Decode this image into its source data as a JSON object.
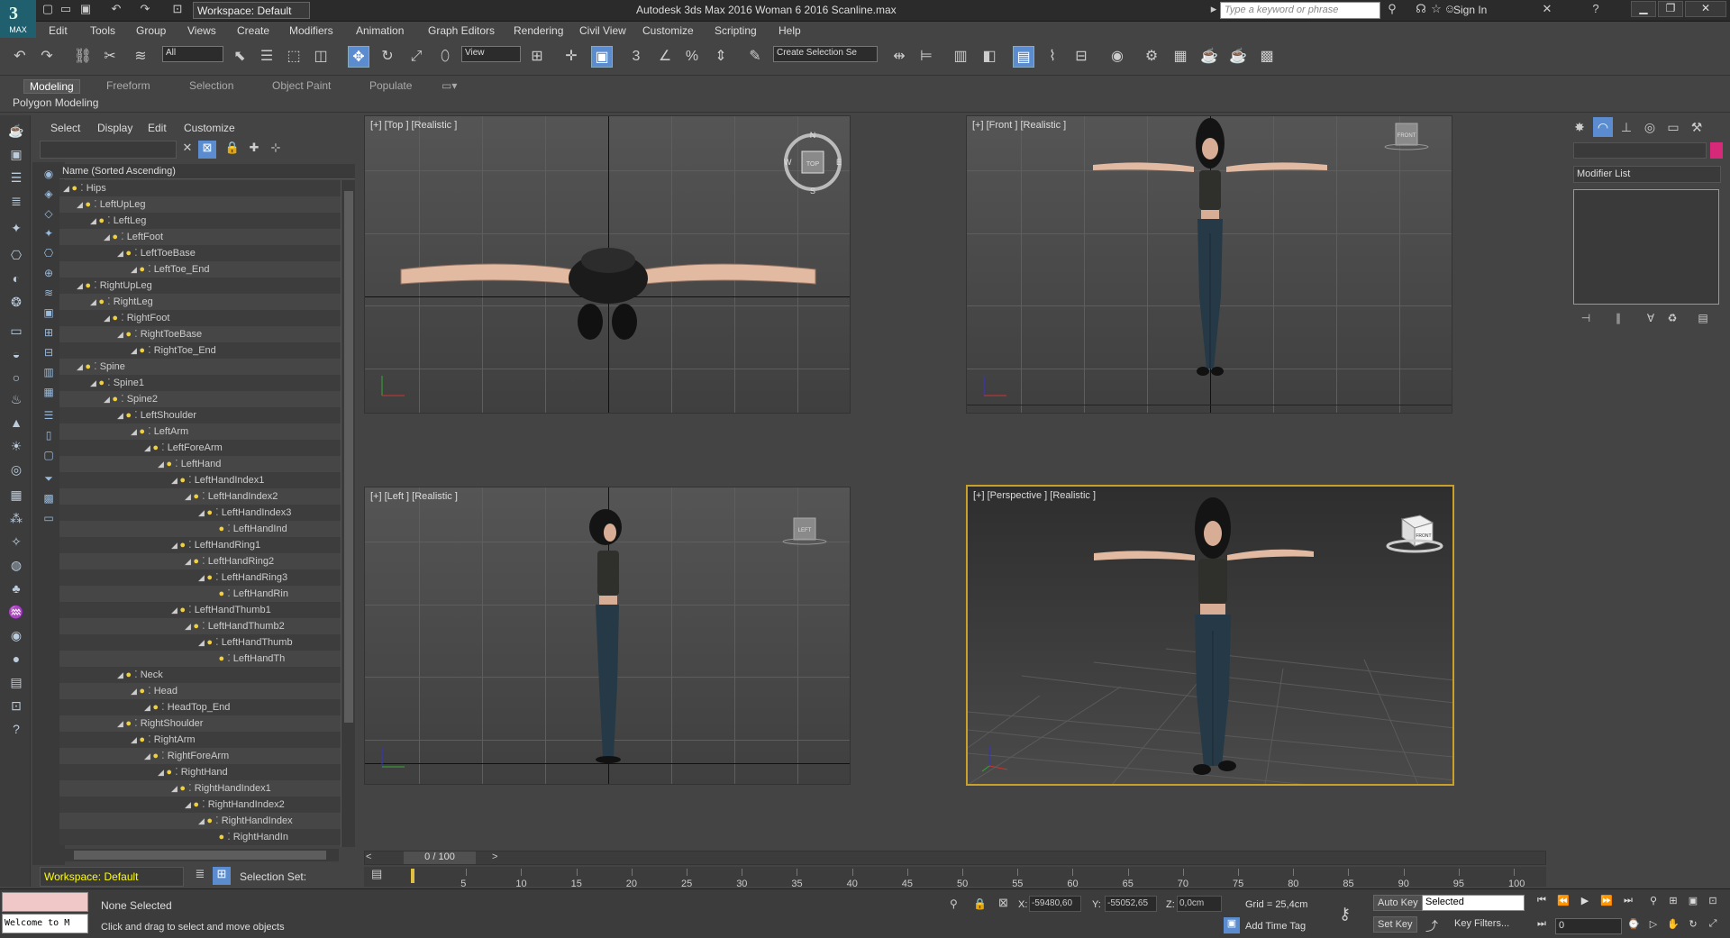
{
  "app": {
    "title": "Autodesk 3ds Max 2016    Woman 6 2016 Scanline.max",
    "logo_text": "MAX",
    "workspace_top": "Workspace: Default",
    "search_placeholder": "Type a keyword or phrase",
    "sign_in": "Sign In"
  },
  "menu": [
    "Edit",
    "Tools",
    "Group",
    "Views",
    "Create",
    "Modifiers",
    "Animation",
    "Graph Editors",
    "Rendering",
    "Civil View",
    "Customize",
    "Scripting",
    "Help"
  ],
  "toolbar": {
    "selection_filter": "All",
    "ref_coord": "View",
    "named_selection": "Create Selection Se"
  },
  "ribbon": {
    "tabs": [
      "Modeling",
      "Freeform",
      "Selection",
      "Object Paint",
      "Populate"
    ],
    "active_tab": "Modeling",
    "panel_label": "Polygon Modeling"
  },
  "explorer": {
    "menus": [
      "Select",
      "Display",
      "Edit",
      "Customize"
    ],
    "column_header": "Name (Sorted Ascending)",
    "tree": [
      {
        "name": "Hips",
        "level": 0
      },
      {
        "name": "LeftUpLeg",
        "level": 1
      },
      {
        "name": "LeftLeg",
        "level": 2
      },
      {
        "name": "LeftFoot",
        "level": 3
      },
      {
        "name": "LeftToeBase",
        "level": 4
      },
      {
        "name": "LeftToe_End",
        "level": 5
      },
      {
        "name": "RightUpLeg",
        "level": 1
      },
      {
        "name": "RightLeg",
        "level": 2
      },
      {
        "name": "RightFoot",
        "level": 3
      },
      {
        "name": "RightToeBase",
        "level": 4
      },
      {
        "name": "RightToe_End",
        "level": 5
      },
      {
        "name": "Spine",
        "level": 1
      },
      {
        "name": "Spine1",
        "level": 2
      },
      {
        "name": "Spine2",
        "level": 3
      },
      {
        "name": "LeftShoulder",
        "level": 4
      },
      {
        "name": "LeftArm",
        "level": 5
      },
      {
        "name": "LeftForeArm",
        "level": 6
      },
      {
        "name": "LeftHand",
        "level": 7
      },
      {
        "name": "LeftHandIndex1",
        "level": 8
      },
      {
        "name": "LeftHandIndex2",
        "level": 9
      },
      {
        "name": "LeftHandIndex3",
        "level": 10
      },
      {
        "name": "LeftHandInd",
        "level": 11
      },
      {
        "name": "LeftHandRing1",
        "level": 8
      },
      {
        "name": "LeftHandRing2",
        "level": 9
      },
      {
        "name": "LeftHandRing3",
        "level": 10
      },
      {
        "name": "LeftHandRin",
        "level": 11
      },
      {
        "name": "LeftHandThumb1",
        "level": 8
      },
      {
        "name": "LeftHandThumb2",
        "level": 9
      },
      {
        "name": "LeftHandThumb",
        "level": 10
      },
      {
        "name": "LeftHandTh",
        "level": 11
      },
      {
        "name": "Neck",
        "level": 4
      },
      {
        "name": "Head",
        "level": 5
      },
      {
        "name": "HeadTop_End",
        "level": 6
      },
      {
        "name": "RightShoulder",
        "level": 4
      },
      {
        "name": "RightArm",
        "level": 5
      },
      {
        "name": "RightForeArm",
        "level": 6
      },
      {
        "name": "RightHand",
        "level": 7
      },
      {
        "name": "RightHandIndex1",
        "level": 8
      },
      {
        "name": "RightHandIndex2",
        "level": 9
      },
      {
        "name": "RightHandIndex",
        "level": 10
      },
      {
        "name": "RightHandIn",
        "level": 11
      }
    ],
    "workspace": "Workspace: Default",
    "selection_set": "Selection Set:"
  },
  "viewports": {
    "top": "[+] [Top ] [Realistic ]",
    "front": "[+] [Front ] [Realistic ]",
    "left": "[+] [Left ] [Realistic ]",
    "perspective": "[+] [Perspective ] [Realistic ]",
    "compass": {
      "n": "N",
      "s": "S",
      "w": "W",
      "e": "E",
      "top": "TOP"
    },
    "cube_front": "FRONT",
    "cube_left": "LEFT"
  },
  "command_panel": {
    "modifier_list": "Modifier List",
    "object_color": "#d6297a"
  },
  "timeline": {
    "slider_label": "0 / 100",
    "ticks": [
      "5",
      "10",
      "15",
      "20",
      "25",
      "30",
      "35",
      "40",
      "45",
      "50",
      "55",
      "60",
      "65",
      "70",
      "75",
      "80",
      "85",
      "90",
      "95",
      "100"
    ]
  },
  "status": {
    "welcome": "Welcome to M",
    "selection": "None Selected",
    "prompt": "Click and drag to select and move objects",
    "x_label": "X:",
    "x_value": "-59480,60",
    "y_label": "Y:",
    "y_value": "-55052,65",
    "z_label": "Z:",
    "z_value": "0,0cm",
    "grid": "Grid = 25,4cm",
    "add_time_tag": "Add Time Tag",
    "auto_key": "Auto Key",
    "set_key": "Set Key",
    "key_mode": "Selected",
    "key_filters": "Key Filters...",
    "frame": "0"
  }
}
